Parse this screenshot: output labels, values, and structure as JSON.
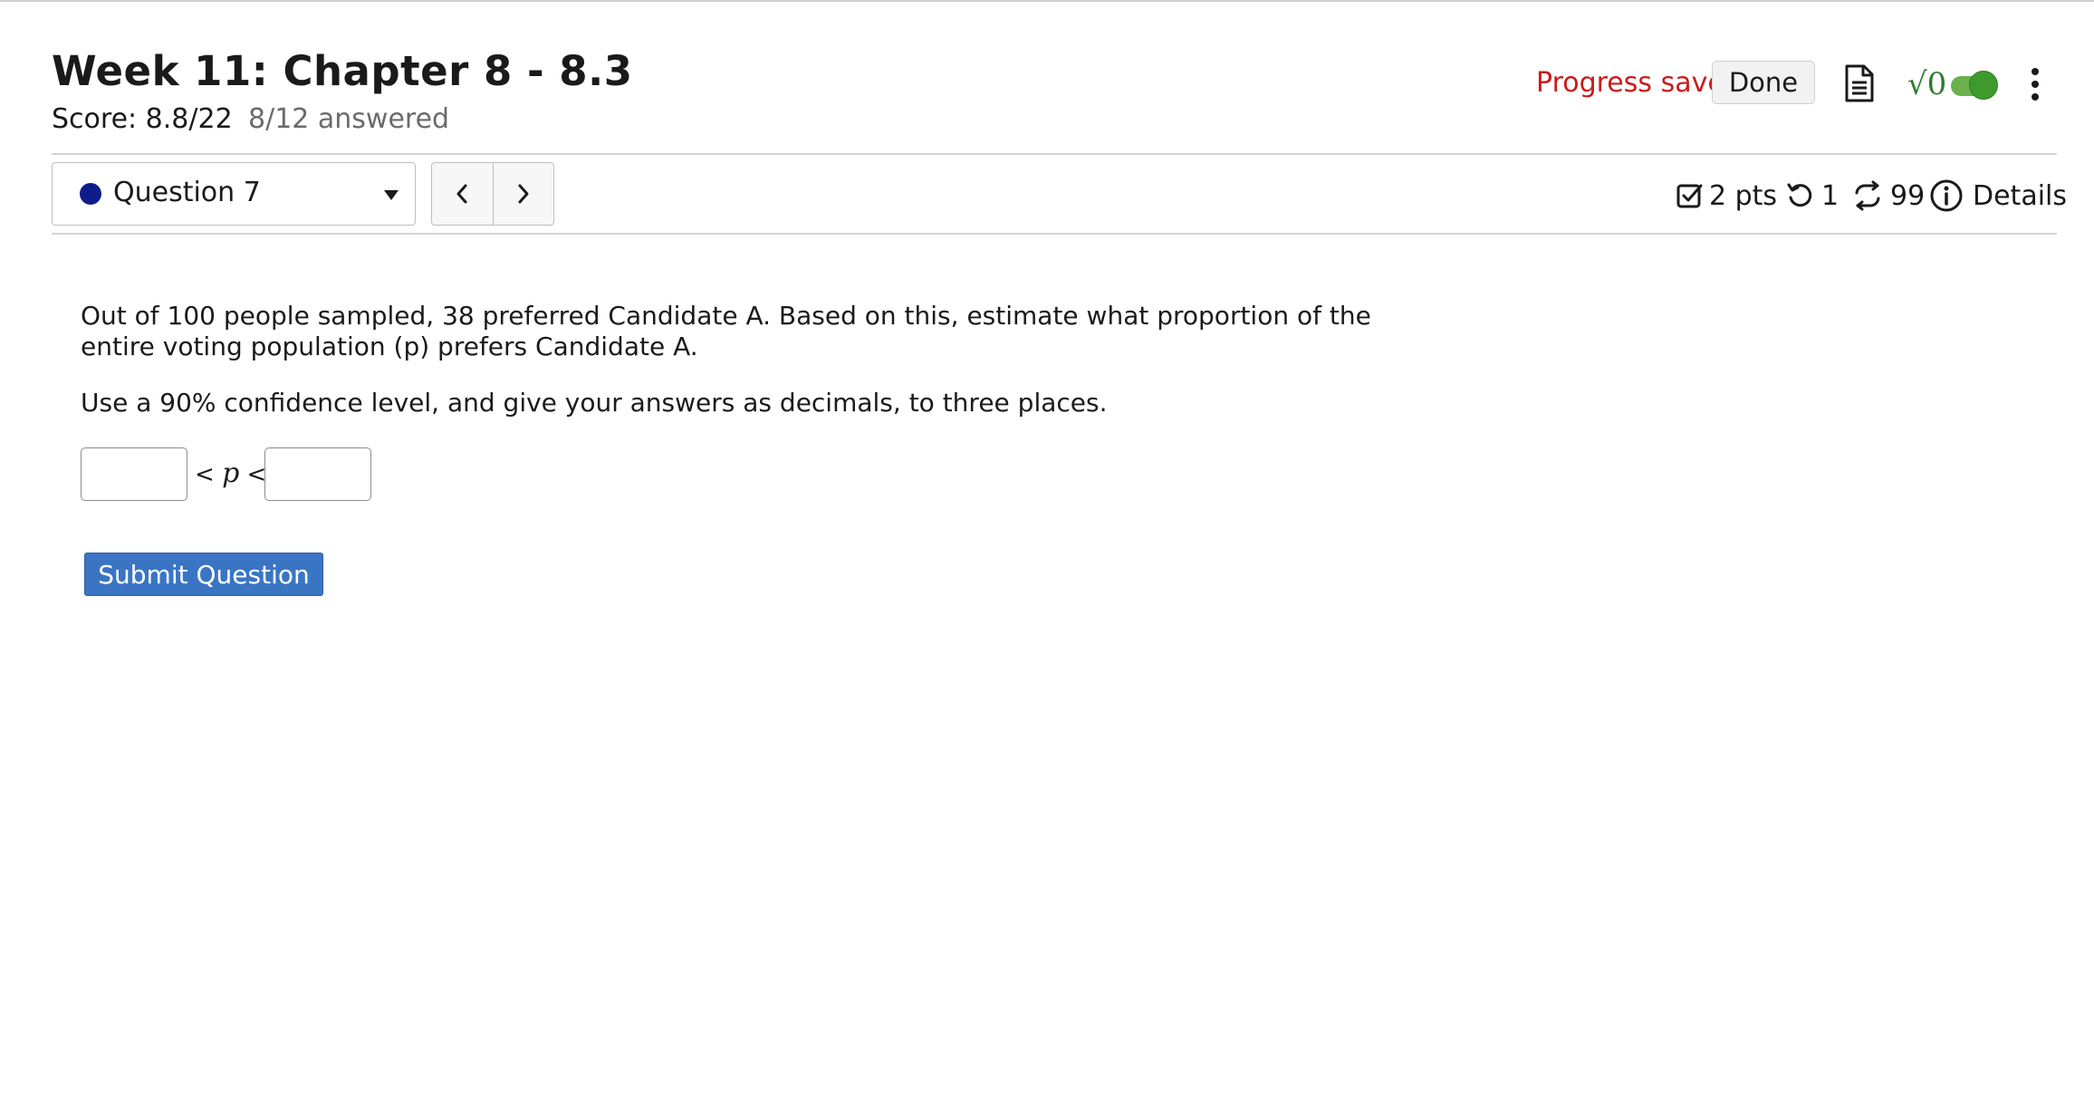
{
  "header": {
    "title": "Week 11: Chapter 8 - 8.3",
    "score": "Score: 8.8/22",
    "answered": "8/12 answered",
    "progress_status": "Progress saved",
    "done_label": "Done",
    "math_symbol": "√0"
  },
  "question_nav": {
    "selected_question": "Question 7",
    "prev_icon": "chevron-left-icon",
    "next_icon": "chevron-right-icon"
  },
  "question_meta": {
    "points": "2 pts",
    "attempts": "1",
    "regenerations": "99",
    "details_label": "Details"
  },
  "question": {
    "text_1": "Out of 100 people sampled, 38 preferred Candidate A. Based on this, estimate what proportion of the entire voting population (p) prefers Candidate A.",
    "text_2": "Use a 90% confidence level, and give your answers as decimals, to three places.",
    "lower_bound_value": "",
    "upper_bound_value": "",
    "inequality_lt_1": "<",
    "inequality_var": "p",
    "inequality_lt_2": "<",
    "submit_label": "Submit Question"
  },
  "colors": {
    "progress_saved": "#c81c1c",
    "question_dot": "#0f1c8c",
    "submit_bg": "#3a75c4",
    "toggle_on": "#3f9a2e"
  }
}
